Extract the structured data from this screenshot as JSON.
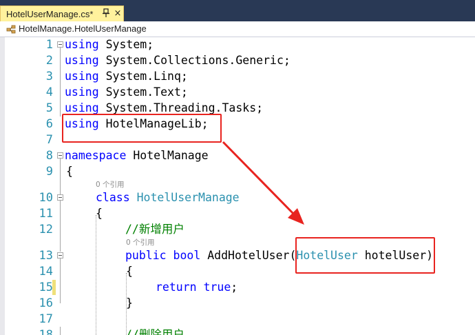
{
  "tab": {
    "title": "HotelUserManage.cs*",
    "close_glyph": "×"
  },
  "nav": {
    "class_path": "HotelManage.HotelUserManage"
  },
  "editor": {
    "line_numbers": [
      "1",
      "2",
      "3",
      "4",
      "5",
      "6",
      "7",
      "8",
      "9",
      "10",
      "11",
      "12",
      "13",
      "14",
      "15",
      "16",
      "17",
      "18"
    ],
    "references_label": "0 个引用",
    "lines": {
      "l1": {
        "kw": "using",
        "rest": " System;"
      },
      "l2": {
        "kw": "using",
        "rest": " System.Collections.Generic;"
      },
      "l3": {
        "kw": "using",
        "rest": " System.Linq;"
      },
      "l4": {
        "kw": "using",
        "rest": " System.Text;"
      },
      "l5": {
        "kw": "using",
        "rest": " System.Threading.Tasks;"
      },
      "l6": {
        "kw": "using",
        "rest": " HotelManageLib;"
      },
      "l8": {
        "kw": "namespace",
        "rest": " HotelManage"
      },
      "l9": {
        "text": "{"
      },
      "l10": {
        "kw": "class",
        "ty": "HotelUserManage"
      },
      "l11": {
        "text": "{"
      },
      "l12": {
        "comment": "//新增用户"
      },
      "l13": {
        "kw1": "public",
        "kw2": "bool",
        "name": "AddHotelUser",
        "paren_open": "(",
        "ty": "HotelUser",
        "param": " hotelUser",
        "paren_close": ")"
      },
      "l14": {
        "text": "{"
      },
      "l15": {
        "kw1": "return",
        "kw2": "true",
        "semi": ";"
      },
      "l16": {
        "text": "}"
      },
      "l18": {
        "comment": "//删除用户"
      }
    }
  },
  "colors": {
    "keyword": "#0000ff",
    "type": "#2b91af",
    "comment": "#008000",
    "annotation": "#e8231f",
    "tab_active": "#fff29d",
    "tab_bar": "#293955"
  }
}
